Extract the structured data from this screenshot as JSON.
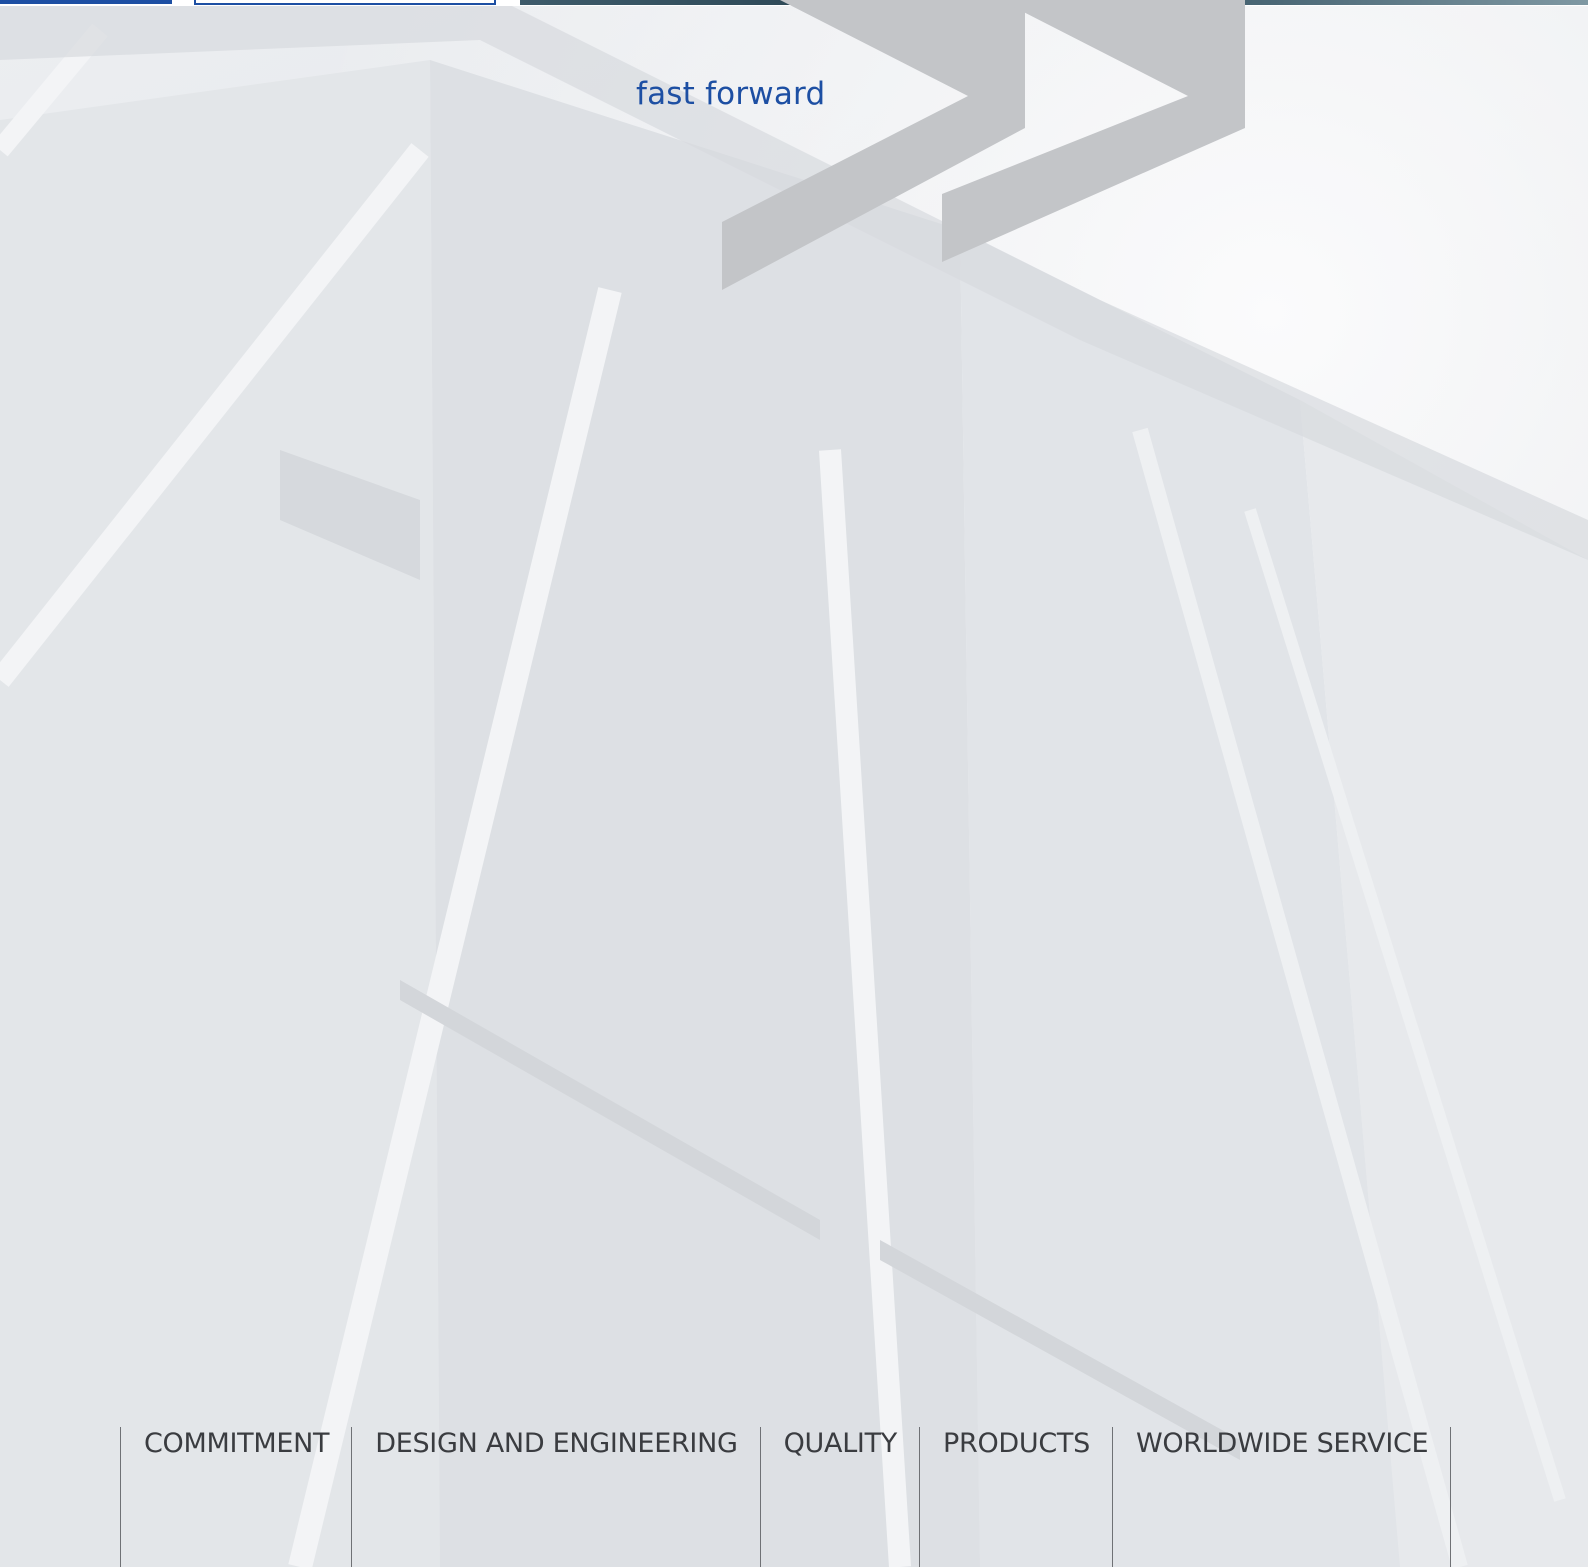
{
  "header": {
    "tagline": "fast forward"
  },
  "colors": {
    "brand_blue": "#1d4fa3",
    "chevron_gray": "#c3c5c8",
    "nav_text": "#3a3c40"
  },
  "icons": {
    "chevrons": "double-chevron-right-icon"
  },
  "nav": {
    "items": [
      {
        "label": "COMMITMENT"
      },
      {
        "label": "DESIGN AND ENGINEERING"
      },
      {
        "label": "QUALITY"
      },
      {
        "label": "PRODUCTS"
      },
      {
        "label": "WORLDWIDE SERVICE"
      }
    ]
  }
}
